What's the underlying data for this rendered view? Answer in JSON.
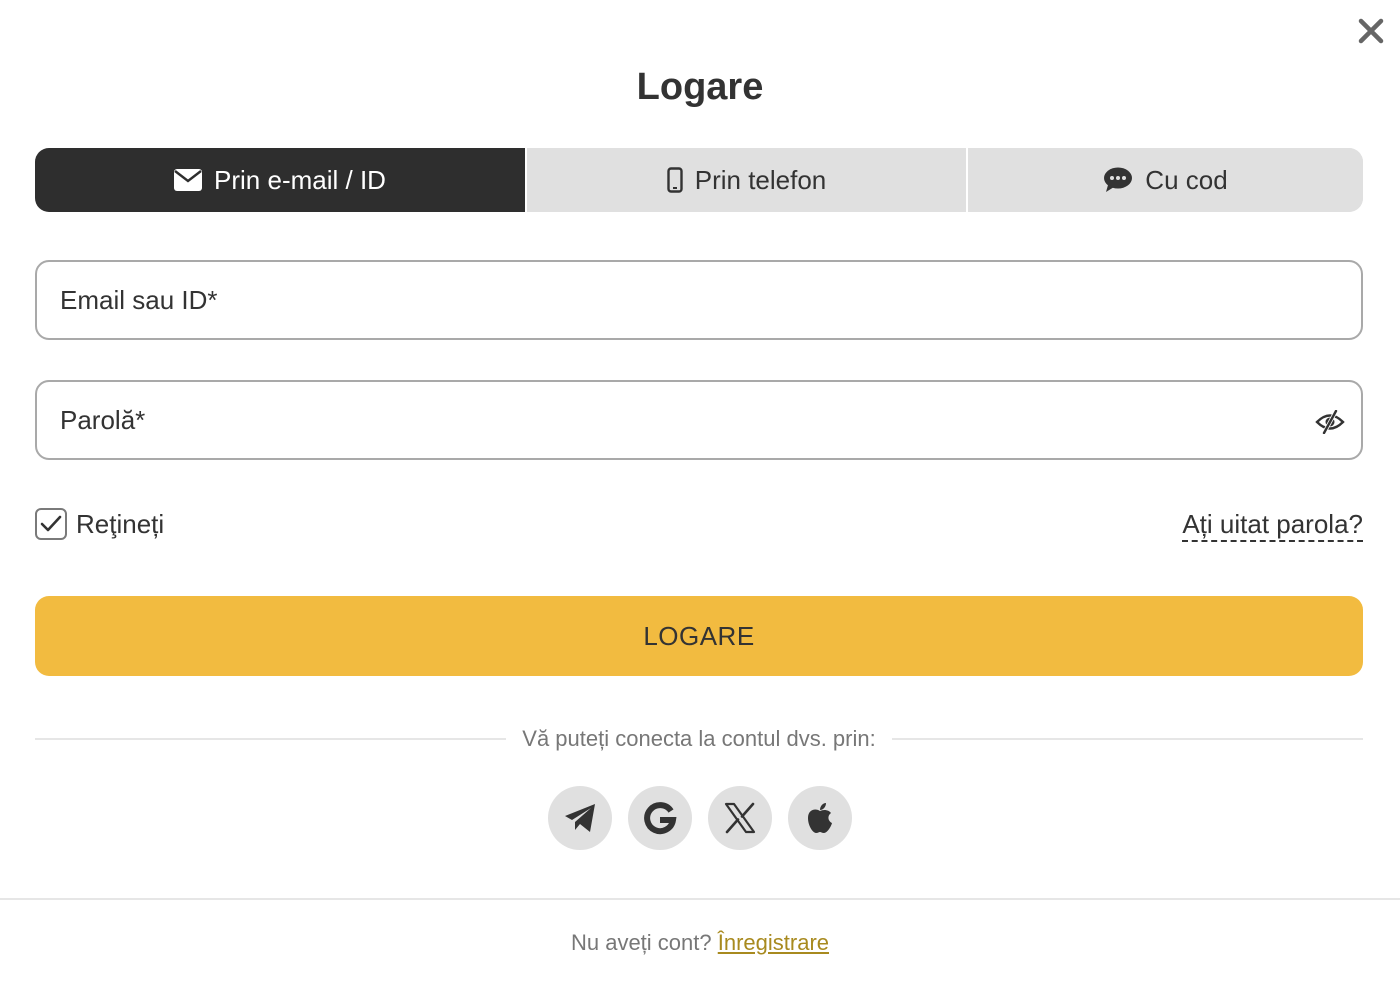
{
  "modal": {
    "title": "Logare",
    "close_icon": "close-icon"
  },
  "tabs": [
    {
      "label": "Prin e-mail / ID",
      "icon": "envelope-icon",
      "active": true
    },
    {
      "label": "Prin telefon",
      "icon": "mobile-phone-icon",
      "active": false
    },
    {
      "label": "Cu cod",
      "icon": "chat-bubble-icon",
      "active": false
    }
  ],
  "form": {
    "email_placeholder": "Email sau ID*",
    "email_value": "",
    "password_placeholder": "Parolă*",
    "password_value": "",
    "password_toggle_icon": "eye-slash-icon",
    "remember_label": "Reţineți",
    "remember_checked": true,
    "forgot_label": "Ați uitat parola?",
    "submit_label": "LOGARE"
  },
  "social": {
    "divider_text": "Vă puteți conecta la contul dvs. prin:",
    "providers": [
      "telegram-icon",
      "google-icon",
      "x-icon",
      "apple-icon"
    ]
  },
  "footer": {
    "prompt": "Nu aveți cont?",
    "register_label": "Înregistrare"
  },
  "colors": {
    "accent": "#f2bb40",
    "active_tab": "#2e2e2e",
    "inactive_tab": "#e0e0e0",
    "link": "#a88a1f"
  }
}
